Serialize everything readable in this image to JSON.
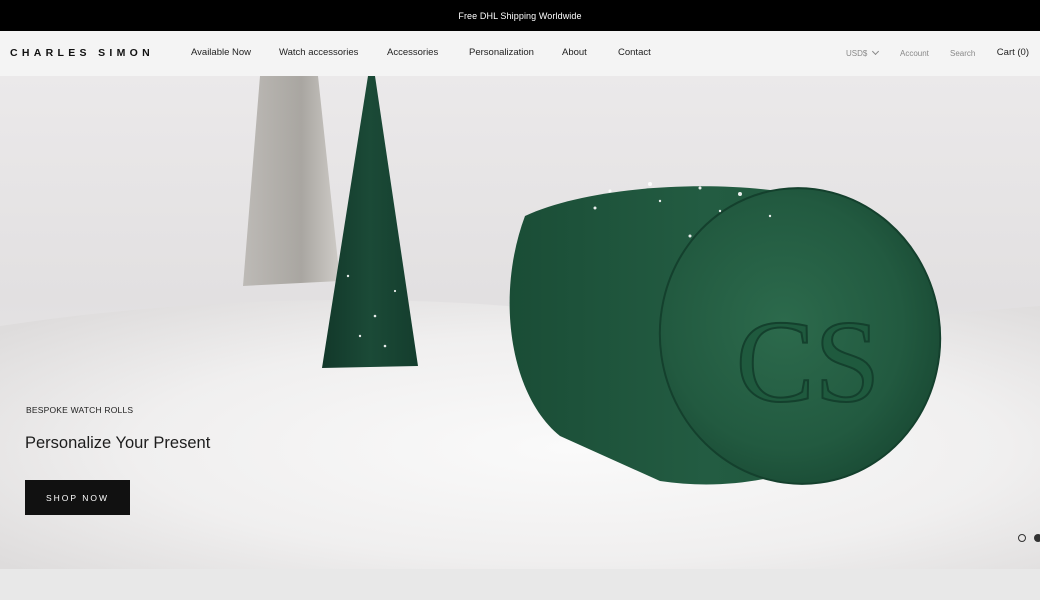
{
  "announcement": {
    "text": "Free DHL Shipping Worldwide"
  },
  "header": {
    "logo": "CHARLES SIMON",
    "nav": [
      {
        "label": "Available Now"
      },
      {
        "label": "Watch accessories"
      },
      {
        "label": "Accessories"
      },
      {
        "label": "Personalization"
      },
      {
        "label": "About"
      },
      {
        "label": "Contact"
      }
    ],
    "currency": "USD$",
    "account": "Account",
    "search": "Search",
    "cart": "Cart (0)"
  },
  "hero": {
    "eyebrow": "BESPOKE WATCH ROLLS",
    "headline": "Personalize Your Present",
    "cta": "SHOP NOW",
    "monogram": "CS",
    "slides": {
      "current": 2,
      "total": 2
    }
  },
  "colors": {
    "announcement_bg": "#000000",
    "header_bg": "#f4f4f4",
    "cta_bg": "#111111",
    "leather_green": "#1f5a3e"
  }
}
